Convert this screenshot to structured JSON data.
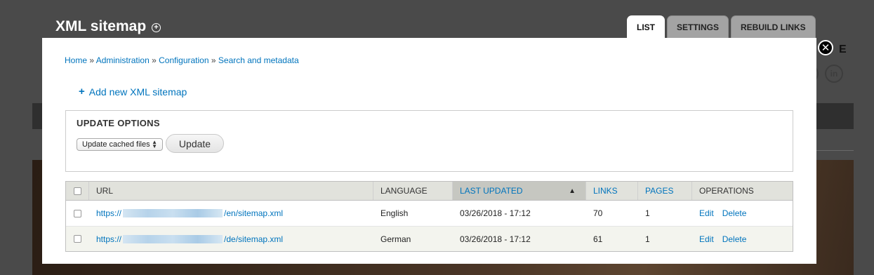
{
  "header": {
    "title": "XML sitemap",
    "tabs": [
      {
        "label": "LIST",
        "active": true
      },
      {
        "label": "SETTINGS",
        "active": false
      },
      {
        "label": "REBUILD LINKS",
        "active": false
      }
    ]
  },
  "background": {
    "partial_letter": "E",
    "social_label": "in"
  },
  "breadcrumb": {
    "items": [
      "Home",
      "Administration",
      "Configuration",
      "Search and metadata"
    ],
    "separator": "»"
  },
  "actions": {
    "add_label": "Add new XML sitemap"
  },
  "update_options": {
    "legend": "UPDATE OPTIONS",
    "select_value": "Update cached files",
    "button_label": "Update"
  },
  "table": {
    "columns": {
      "url": "URL",
      "language": "LANGUAGE",
      "last_updated": "LAST UPDATED",
      "links": "LINKS",
      "pages": "PAGES",
      "operations": "OPERATIONS"
    },
    "rows": [
      {
        "url_prefix": "https://",
        "url_suffix": "/en/sitemap.xml",
        "language": "English",
        "last_updated": "03/26/2018 - 17:12",
        "links": "70",
        "pages": "1",
        "edit": "Edit",
        "delete": "Delete"
      },
      {
        "url_prefix": "https://",
        "url_suffix": "/de/sitemap.xml",
        "language": "German",
        "last_updated": "03/26/2018 - 17:12",
        "links": "61",
        "pages": "1",
        "edit": "Edit",
        "delete": "Delete"
      }
    ]
  },
  "colors": {
    "link": "#0074bd",
    "overlay": "#4a4a4a",
    "header_bg": "#e1e2dc",
    "sorted_bg": "#c6c7c1"
  }
}
